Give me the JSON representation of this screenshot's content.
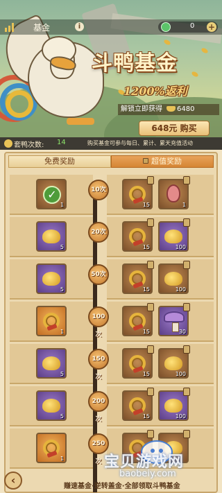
{
  "topbar": {
    "title": "基金",
    "currency_value": "0",
    "plus_label": "+"
  },
  "banner": {
    "headline": "斗鸭基金",
    "rebate": "1200%返利",
    "unlock_text": "解锁立即获得",
    "unlock_amount": "6480",
    "buy_label": "648元 购买"
  },
  "strip": {
    "count_label": "套鸭次数:",
    "count_value": "14",
    "note": "购买基金可参与每日、累计、累天充值活动"
  },
  "tabs": {
    "free": "免费奖励",
    "premium": "超值奖励"
  },
  "rows": [
    {
      "tier": "10次",
      "free": {
        "type": "claimed",
        "color": "brown",
        "qty": "1"
      },
      "premium": [
        {
          "type": "ring",
          "color": "brown",
          "qty": "15"
        },
        {
          "type": "egg",
          "color": "brown",
          "qty": "1"
        }
      ]
    },
    {
      "tier": "20次",
      "free": {
        "type": "gold",
        "color": "purple",
        "qty": "5"
      },
      "premium": [
        {
          "type": "ring",
          "color": "brown",
          "qty": "15"
        },
        {
          "type": "gold",
          "color": "purple",
          "qty": "100"
        }
      ]
    },
    {
      "tier": "50次",
      "free": {
        "type": "gold",
        "color": "purple",
        "qty": "5"
      },
      "premium": [
        {
          "type": "ring",
          "color": "brown",
          "qty": "15"
        },
        {
          "type": "gold",
          "color": "brown",
          "qty": "100"
        }
      ]
    },
    {
      "tier": "100次",
      "free": {
        "type": "ring",
        "color": "orange",
        "qty": "1"
      },
      "premium": [
        {
          "type": "ring",
          "color": "brown",
          "qty": "15"
        },
        {
          "type": "mushroom",
          "color": "purple",
          "qty": "30"
        }
      ]
    },
    {
      "tier": "150次",
      "free": {
        "type": "gold",
        "color": "purple",
        "qty": "5"
      },
      "premium": [
        {
          "type": "ring",
          "color": "brown",
          "qty": "15"
        },
        {
          "type": "gold",
          "color": "brown",
          "qty": "100"
        }
      ]
    },
    {
      "tier": "200次",
      "free": {
        "type": "gold",
        "color": "purple",
        "qty": "5"
      },
      "premium": [
        {
          "type": "ring",
          "color": "brown",
          "qty": "15"
        },
        {
          "type": "gold",
          "color": "purple",
          "qty": "100"
        }
      ]
    },
    {
      "tier": "250次",
      "free": {
        "type": "ring",
        "color": "orange",
        "qty": "1"
      },
      "premium": [
        {
          "type": "ring",
          "color": "brown",
          "qty": "15"
        },
        {
          "type": "gold",
          "color": "brown",
          "qty": ""
        }
      ]
    }
  ],
  "footer": {
    "text": "赚速基金·逆转盖金·全部领取斗鸭基金"
  },
  "watermark": {
    "text": "宝贝游戏网",
    "url": "baobeiy.com"
  }
}
